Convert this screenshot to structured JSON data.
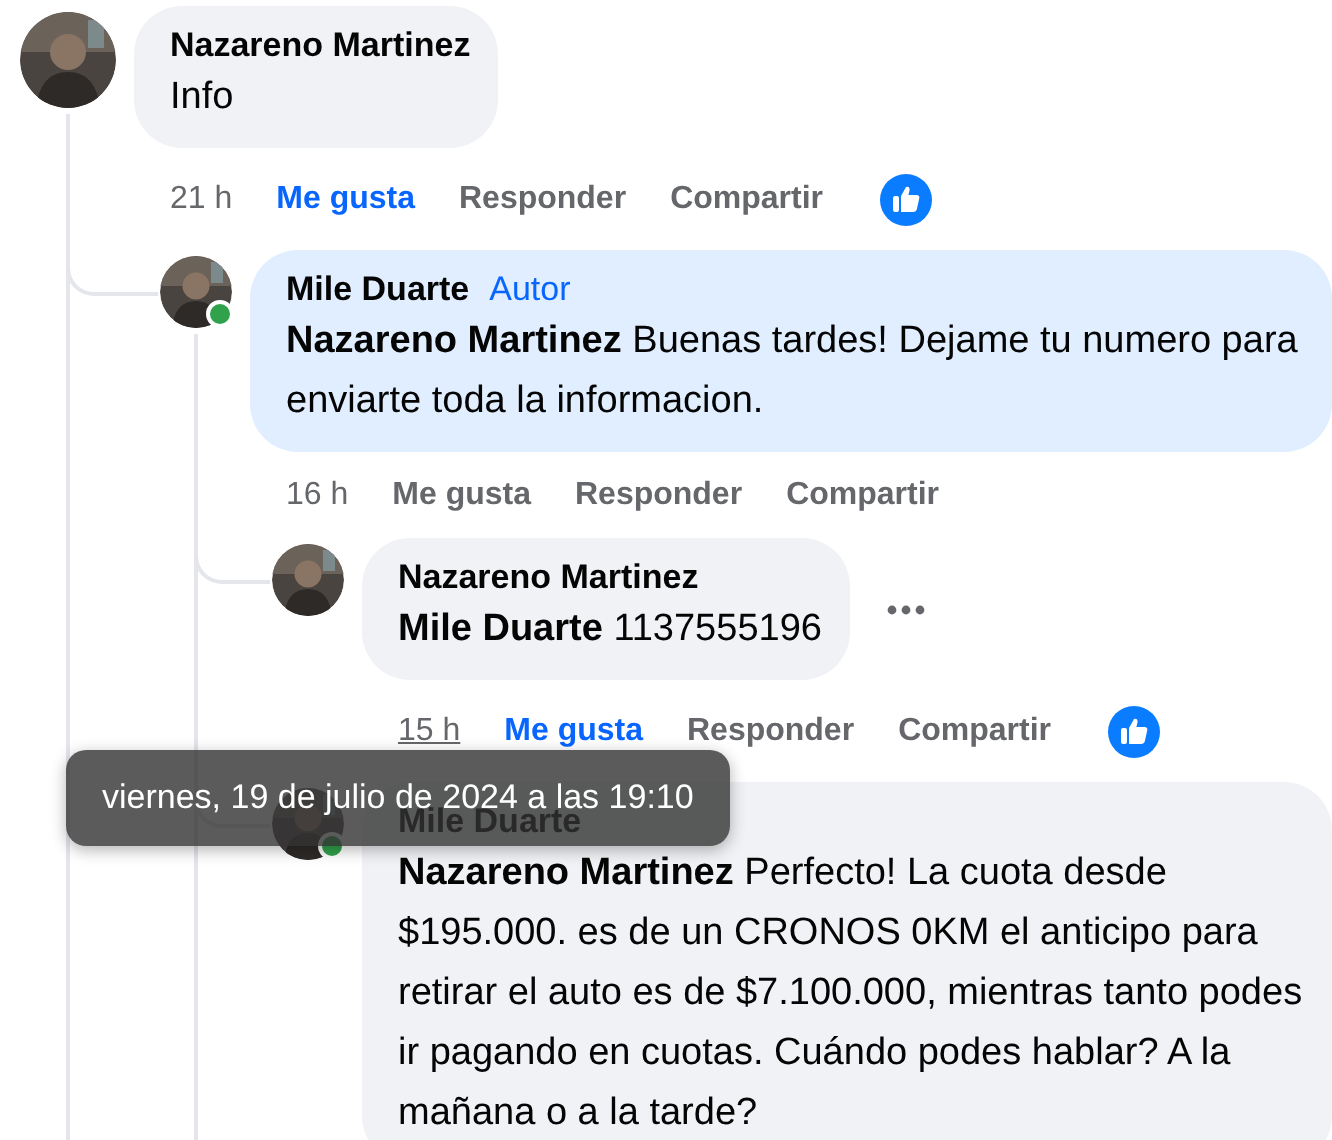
{
  "comments": [
    {
      "author": "Nazareno Martinez",
      "text": "Info",
      "highlighted": false,
      "online": false,
      "show_more": false,
      "actions": {
        "time": "21 h",
        "time_hovered": false,
        "like": "Me gusta",
        "liked": true,
        "reply": "Responder",
        "share": "Compartir",
        "reaction": true
      },
      "children": [
        {
          "author": "Mile Duarte",
          "badge": "Autor",
          "text": "**Nazareno Martinez** Buenas tardes! Dejame tu numero para enviarte toda la informacion.",
          "highlighted": true,
          "online": true,
          "show_more": false,
          "actions": {
            "time": "16 h",
            "time_hovered": false,
            "like": "Me gusta",
            "liked": false,
            "reply": "Responder",
            "share": "Compartir",
            "reaction": false
          },
          "children": [
            {
              "author": "Nazareno Martinez",
              "text": "**Mile Duarte** 1137555196",
              "highlighted": false,
              "online": false,
              "show_more": true,
              "actions": {
                "time": "15 h",
                "time_hovered": true,
                "like": "Me gusta",
                "liked": true,
                "reply": "Responder",
                "share": "Compartir",
                "reaction": true
              }
            },
            {
              "author": "Mile Duarte",
              "text": "**Nazareno Martinez** Perfecto! La cuota desde $195.000. es de un CRONOS 0KM el anticipo para retirar el auto es de $7.100.000, mientras tanto podes ir pagando en cuotas. Cuándo podes hablar? A la mañana o a la tarde?",
              "highlighted": false,
              "online": true,
              "show_more": false
            }
          ]
        }
      ]
    }
  ],
  "tooltip": {
    "text": "viernes, 19 de julio de 2024 a las 19:10"
  }
}
